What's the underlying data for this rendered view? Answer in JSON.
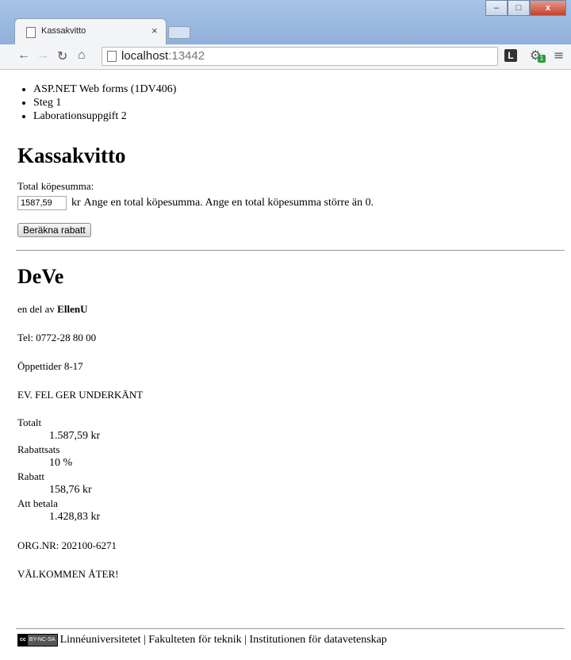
{
  "browser": {
    "tab_title": "Kassakvitto",
    "tab_close": "×",
    "url_host": "localhost",
    "url_port": ":13442",
    "ext1_label": "L",
    "ext2_badge": "1",
    "win_min": "–",
    "win_max": "□",
    "win_close": "x"
  },
  "breadcrumb": [
    "ASP.NET Web forms (1DV406)",
    "Steg 1",
    "Laborationsuppgift 2"
  ],
  "form": {
    "heading": "Kassakvitto",
    "label": "Total köpesumma:",
    "amount_value": "1587,59",
    "currency": "kr",
    "error_text": "Ange en total köpesumma. Ange en total köpesumma större än 0.",
    "button_label": "Beräkna rabatt"
  },
  "receipt": {
    "store_name": "DeVe",
    "part_of_prefix": "en del av",
    "part_of_name": "EllenU",
    "phone": "Tel: 0772-28 80 00",
    "hours": "Öppettider 8-17",
    "warning": "EV. FEL GER UNDERKÄNT",
    "lines": [
      {
        "label": "Totalt",
        "value": "1.587,59 kr"
      },
      {
        "label": "Rabattsats",
        "value": "10 %"
      },
      {
        "label": "Rabatt",
        "value": "158,76 kr"
      },
      {
        "label": "Att betala",
        "value": "1.428,83 kr"
      }
    ],
    "org_nr": "ORG.NR: 202100-6271",
    "welcome": "VÄLKOMMEN ÅTER!"
  },
  "footer": {
    "cc_label": "cc",
    "license_label": "BY-NC-SA",
    "text": "Linnéuniversitetet | Fakulteten för teknik | Institutionen för datavetenskap"
  }
}
